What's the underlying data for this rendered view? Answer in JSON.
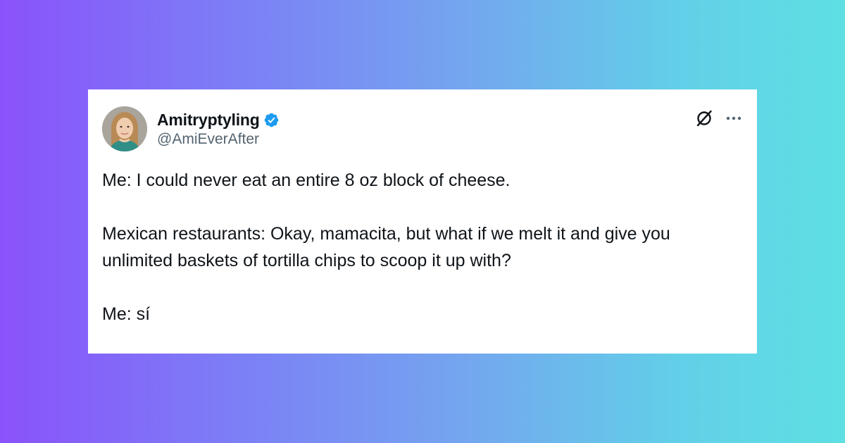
{
  "tweet": {
    "author": {
      "display_name": "Amitryptyling",
      "handle": "@AmiEverAfter",
      "verified": true,
      "avatar": "avatar-woman-portrait"
    },
    "icons": {
      "verified": "verified-badge-icon",
      "grok": "grok-icon",
      "more": "more-options-icon"
    },
    "text": {
      "line1": "Me: I could never eat an entire 8 oz block of cheese.",
      "line2": "Mexican restaurants: Okay, mamacita, but what if we melt it and give you unlimited baskets of tortilla chips to scoop it up with?",
      "line3": "Me: sí"
    }
  },
  "colors": {
    "verified_blue": "#1d9bf0",
    "background_gradient_start": "#8a52fb",
    "background_gradient_end": "#5ee0e3",
    "text_primary": "#0f1419",
    "text_secondary": "#536471"
  }
}
